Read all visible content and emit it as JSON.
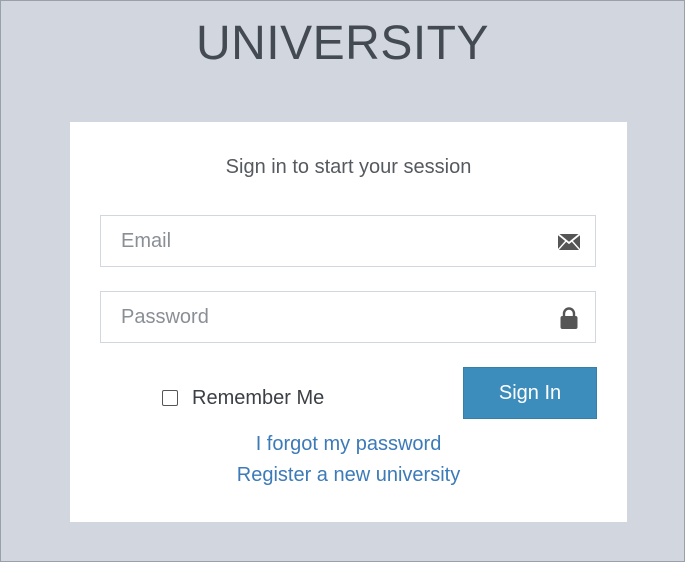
{
  "logo": {
    "text": "UNIVERSITY"
  },
  "login": {
    "message": "Sign in to start your session",
    "email_placeholder": "Email",
    "password_placeholder": "Password",
    "remember_label": "Remember Me",
    "signin_label": "Sign In",
    "forgot_link": "I forgot my password",
    "register_link": "Register a new university",
    "remember_checked": false
  },
  "icons": {
    "email": "envelope-icon",
    "password": "lock-icon"
  },
  "colors": {
    "background": "#d2d6de",
    "primary": "#3c8dbc",
    "link": "#3c7ab8"
  }
}
